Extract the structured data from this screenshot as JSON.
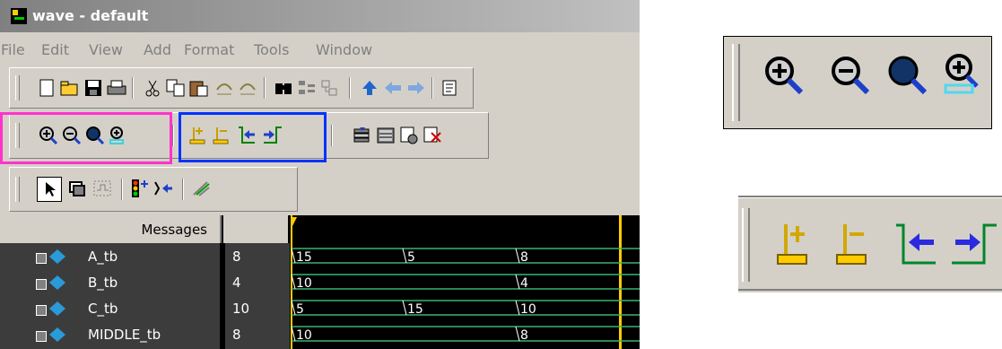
{
  "window": {
    "title": "wave - default",
    "menu": [
      "File",
      "Edit",
      "View",
      "Add",
      "Format",
      "Tools",
      "Window"
    ]
  },
  "toolbars": {
    "standard": [
      "new-file-icon",
      "open-folder-icon",
      "save-icon",
      "print-icon",
      "cut-icon",
      "copy-icon",
      "paste-icon",
      "undo-icon",
      "redo-icon",
      "find-icon",
      "compare-icon",
      "hierarchy-icon",
      "up-arrow-icon",
      "back-icon",
      "forward-icon",
      "list-icon"
    ],
    "zoom": [
      "zoom-in-icon",
      "zoom-out-icon",
      "zoom-full-icon",
      "zoom-cursor-icon"
    ],
    "cursor": [
      "add-cursor-icon",
      "delete-cursor-icon",
      "previous-edge-icon",
      "next-edge-icon"
    ],
    "misc": [
      "dataset-icon",
      "memory-icon",
      "bookmark-icon",
      "delete-bookmark-icon"
    ],
    "select": [
      "select-pointer-icon",
      "zoom-mode-icon",
      "edit-mode-icon",
      "signal-icon",
      "insert-icon",
      "waveform-compare-icon"
    ]
  },
  "wave": {
    "header": "Messages",
    "signals": [
      {
        "name": "A_tb",
        "value": "8",
        "transitions": [
          "15",
          "5",
          "8"
        ]
      },
      {
        "name": "B_tb",
        "value": "4",
        "transitions": [
          "10",
          "",
          "4"
        ]
      },
      {
        "name": "C_tb",
        "value": "10",
        "transitions": [
          "5",
          "15",
          "10"
        ]
      },
      {
        "name": "MIDDLE_tb",
        "value": "8",
        "transitions": [
          "10",
          "",
          "8"
        ]
      }
    ]
  },
  "colors": {
    "zoom_highlight": "#ff33cc",
    "cursor_highlight": "#0033ff",
    "wave_green": "#3cb371",
    "cursor_yellow": "#ffcc00"
  }
}
